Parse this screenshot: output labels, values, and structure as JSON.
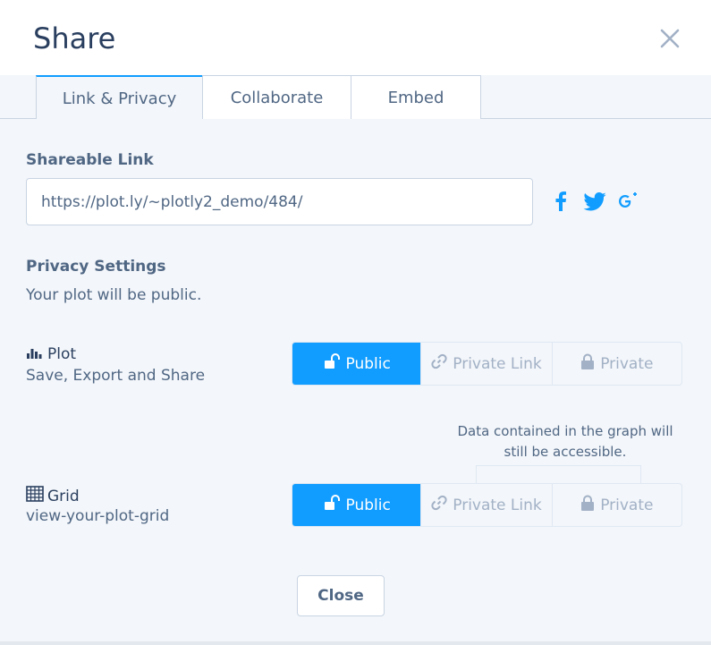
{
  "header": {
    "title": "Share"
  },
  "tabs": [
    {
      "label": "Link & Privacy",
      "active": true
    },
    {
      "label": "Collaborate",
      "active": false
    },
    {
      "label": "Embed",
      "active": false
    }
  ],
  "shareable_link": {
    "label": "Shareable Link",
    "value": "https://plot.ly/~plotly2_demo/484/",
    "social": [
      "facebook-icon",
      "twitter-icon",
      "google-plus-icon"
    ]
  },
  "privacy": {
    "label": "Privacy Settings",
    "status": "Your plot will be public.",
    "plot": {
      "title": "Plot",
      "subtitle": "Save, Export and Share",
      "options": [
        "Public",
        "Private Link",
        "Private"
      ],
      "selected": "Public"
    },
    "tooltip": "Data contained in the graph will still be accessible.",
    "grid": {
      "title": "Grid",
      "subtitle": "view-your-plot-grid",
      "options": [
        "Public",
        "Private Link",
        "Private"
      ],
      "selected": "Public"
    }
  },
  "footer": {
    "close_label": "Close"
  },
  "colors": {
    "accent": "#119dff",
    "text": "#506784",
    "heading": "#2a3f5f",
    "panel": "#f3f6fa"
  }
}
